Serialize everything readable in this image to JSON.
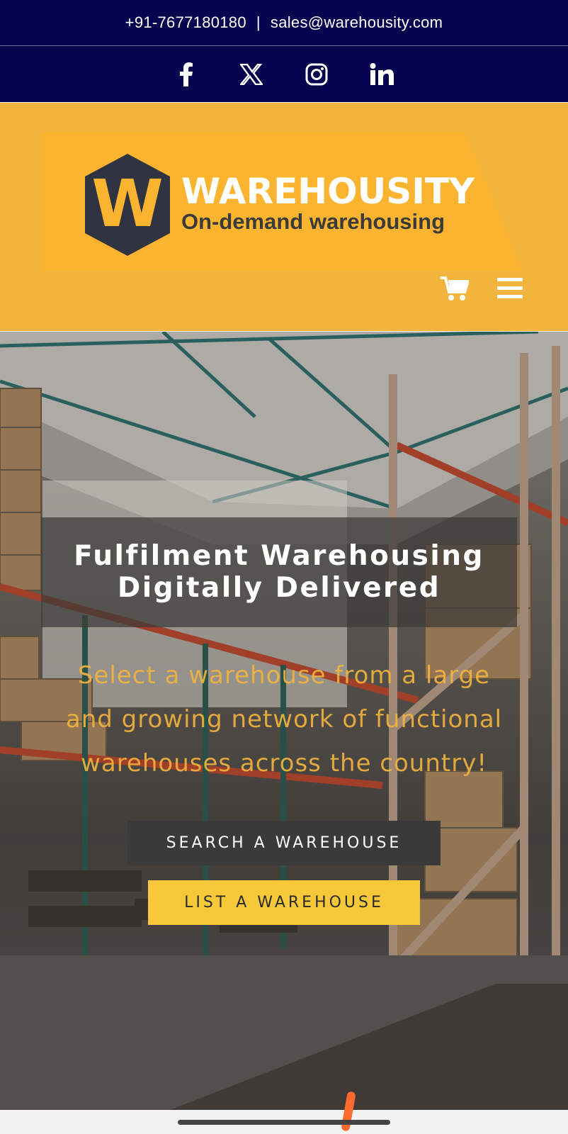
{
  "contact": {
    "phone": "+91-7677180180",
    "separator": "|",
    "email": "sales@warehousity.com"
  },
  "social": [
    {
      "icon": "facebook-icon"
    },
    {
      "icon": "x-twitter-icon"
    },
    {
      "icon": "instagram-icon"
    },
    {
      "icon": "linkedin-icon"
    }
  ],
  "logo": {
    "letter": "W",
    "brand": "WAREHOUSITY",
    "tagline": "On-demand warehousing"
  },
  "header_icons": [
    "cart-icon",
    "menu-icon"
  ],
  "hero": {
    "title_line1": "Fulfilment Warehousing",
    "title_line2": "Digitally Delivered",
    "subtitle_line1": "Select a warehouse from a large",
    "subtitle_line2": "and growing network of functional",
    "subtitle_line3": "warehouses across the country!",
    "search_button": "SEARCH A WAREHOUSE",
    "list_button": "LIST A WAREHOUSE"
  },
  "colors": {
    "topbar": "#06034f",
    "header": "#f3b43e",
    "accent_yellow": "#f7c93a",
    "dark_button": "#3a3a3a"
  }
}
